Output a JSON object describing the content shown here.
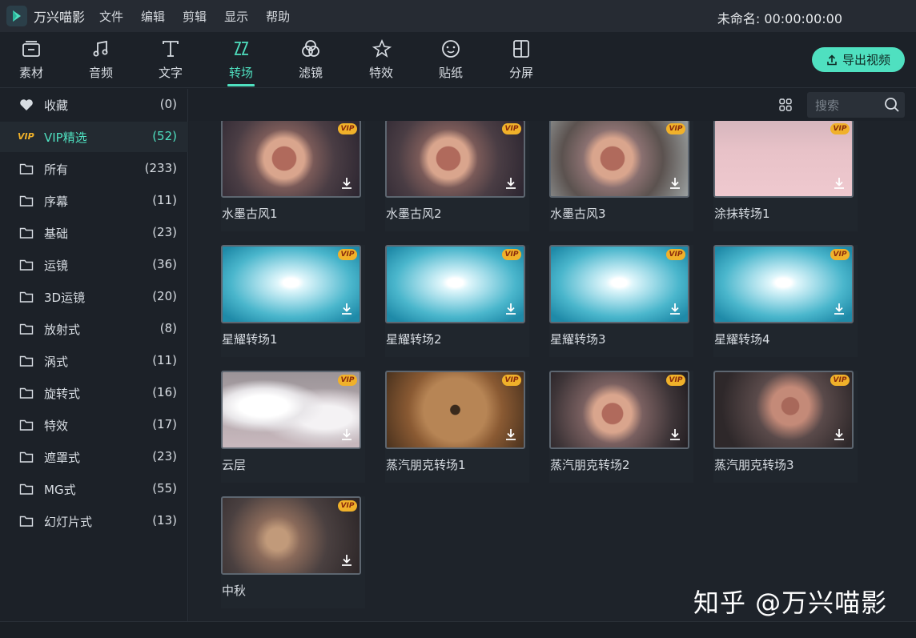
{
  "app": {
    "name": "万兴喵影",
    "project_label": "未命名: 00:00:00:00"
  },
  "menu": [
    "文件",
    "编辑",
    "剪辑",
    "显示",
    "帮助"
  ],
  "toolbar": {
    "tabs": [
      {
        "label": "素材",
        "icon": "media-icon"
      },
      {
        "label": "音频",
        "icon": "music-icon"
      },
      {
        "label": "文字",
        "icon": "text-icon"
      },
      {
        "label": "转场",
        "icon": "transition-icon",
        "active": true
      },
      {
        "label": "滤镜",
        "icon": "filter-icon"
      },
      {
        "label": "特效",
        "icon": "effects-icon"
      },
      {
        "label": "贴纸",
        "icon": "sticker-icon"
      },
      {
        "label": "分屏",
        "icon": "split-screen-icon"
      }
    ],
    "export_label": "导出视频"
  },
  "sidebar": {
    "items": [
      {
        "label": "收藏",
        "count": "(0)",
        "icon": "heart-icon"
      },
      {
        "label": "VIP精选",
        "count": "(52)",
        "icon": "vip-icon",
        "selected": true
      },
      {
        "label": "所有",
        "count": "(233)",
        "icon": "folder-icon"
      },
      {
        "label": "序幕",
        "count": "(11)",
        "icon": "folder-icon"
      },
      {
        "label": "基础",
        "count": "(23)",
        "icon": "folder-icon"
      },
      {
        "label": "运镜",
        "count": "(36)",
        "icon": "folder-icon"
      },
      {
        "label": "3D运镜",
        "count": "(20)",
        "icon": "folder-icon"
      },
      {
        "label": "放射式",
        "count": "(8)",
        "icon": "folder-icon"
      },
      {
        "label": "涡式",
        "count": "(11)",
        "icon": "folder-icon"
      },
      {
        "label": "旋转式",
        "count": "(16)",
        "icon": "folder-icon"
      },
      {
        "label": "特效",
        "count": "(17)",
        "icon": "folder-icon"
      },
      {
        "label": "遮罩式",
        "count": "(23)",
        "icon": "folder-icon"
      },
      {
        "label": "MG式",
        "count": "(55)",
        "icon": "folder-icon"
      },
      {
        "label": "幻灯片式",
        "count": "(13)",
        "icon": "folder-icon"
      }
    ]
  },
  "search": {
    "placeholder": "搜索"
  },
  "badge_text": "VIP",
  "transitions": [
    {
      "label": "水墨古风1",
      "theme": "t-ink"
    },
    {
      "label": "水墨古风2",
      "theme": "t-ink"
    },
    {
      "label": "水墨古风3",
      "theme": "t-ink3"
    },
    {
      "label": "涂抹转场1",
      "theme": "t-smear"
    },
    {
      "label": "星耀转场1",
      "theme": "t-star"
    },
    {
      "label": "星耀转场2",
      "theme": "t-star"
    },
    {
      "label": "星耀转场3",
      "theme": "t-star"
    },
    {
      "label": "星耀转场4",
      "theme": "t-star"
    },
    {
      "label": "云层",
      "theme": "t-cloud"
    },
    {
      "label": "蒸汽朋克转场1",
      "theme": "t-steam1"
    },
    {
      "label": "蒸汽朋克转场2",
      "theme": "t-steam2"
    },
    {
      "label": "蒸汽朋克转场3",
      "theme": "t-steam3"
    },
    {
      "label": "中秋",
      "theme": "t-mid"
    }
  ],
  "watermark": "知乎 @万兴喵影",
  "colors": {
    "accent": "#4fe0c0",
    "vip_badge": "#f0b12a"
  }
}
